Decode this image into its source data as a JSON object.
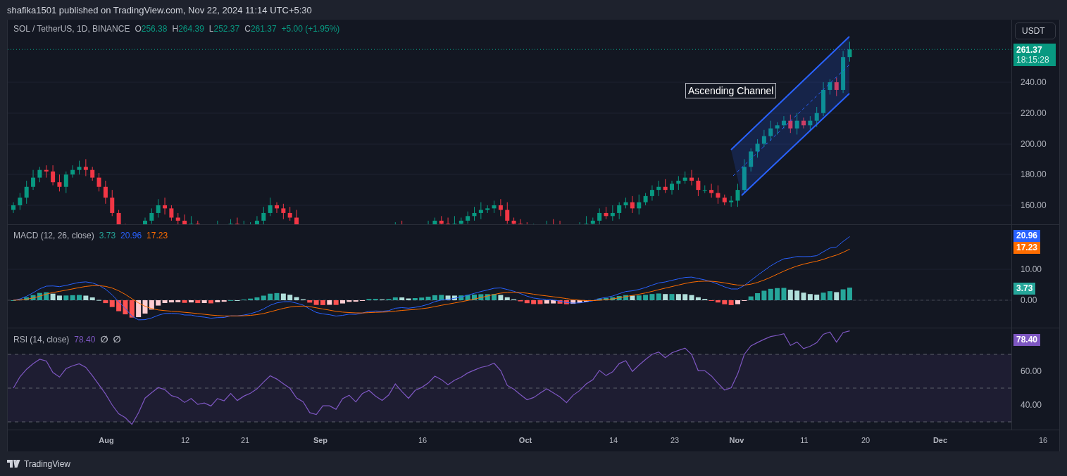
{
  "header": {
    "published": "shafika1501 published on TradingView.com, Nov 22, 2024 11:14 UTC+5:30"
  },
  "price_pane": {
    "symbol": "SOL / TetherUS, 1D, BINANCE",
    "ohlc": [
      {
        "label": "O",
        "value": "256.38"
      },
      {
        "label": "H",
        "value": "264.39"
      },
      {
        "label": "L",
        "value": "252.37"
      },
      {
        "label": "C",
        "value": "261.37"
      }
    ],
    "change": "+5.00 (+1.95%)",
    "annotation": "Ascending Channel",
    "currency_button": "USDT",
    "last_price": {
      "price": "261.37",
      "countdown": "18:15:28",
      "color": "#089981"
    },
    "axis_labels": [
      "240.00",
      "220.00",
      "200.00",
      "180.00",
      "160.00"
    ]
  },
  "macd_pane": {
    "title": "MACD (12, 26, close)",
    "values": [
      {
        "text": "3.73",
        "color": "#26a69a"
      },
      {
        "text": "20.96",
        "color": "#2962ff"
      },
      {
        "text": "17.23",
        "color": "#ff6d00"
      }
    ],
    "badges": [
      {
        "text": "20.96",
        "color": "#2962ff"
      },
      {
        "text": "17.23",
        "color": "#ff6d00"
      },
      {
        "text": "3.73",
        "color": "#26a69a"
      }
    ],
    "axis_labels": [
      "10.00",
      "0.00"
    ]
  },
  "rsi_pane": {
    "title": "RSI (14, close)",
    "values": [
      {
        "text": "78.40",
        "color": "#7e57c2"
      },
      {
        "text": "∅",
        "color": "#b2b5be"
      },
      {
        "text": "∅",
        "color": "#b2b5be"
      }
    ],
    "badges": [
      {
        "text": "78.40",
        "color": "#7e57c2"
      }
    ],
    "axis_labels": [
      "60.00",
      "40.00"
    ]
  },
  "time_axis": [
    {
      "label": "Aug",
      "kind": "month"
    },
    {
      "label": "12",
      "kind": "day"
    },
    {
      "label": "21",
      "kind": "day"
    },
    {
      "label": "Sep",
      "kind": "month"
    },
    {
      "label": "16",
      "kind": "day"
    },
    {
      "label": "Oct",
      "kind": "month"
    },
    {
      "label": "14",
      "kind": "day"
    },
    {
      "label": "23",
      "kind": "day"
    },
    {
      "label": "Nov",
      "kind": "month"
    },
    {
      "label": "11",
      "kind": "day"
    },
    {
      "label": "20",
      "kind": "day"
    },
    {
      "label": "Dec",
      "kind": "month"
    },
    {
      "label": "16",
      "kind": "day"
    }
  ],
  "footer": {
    "brand": "TradingView"
  }
}
